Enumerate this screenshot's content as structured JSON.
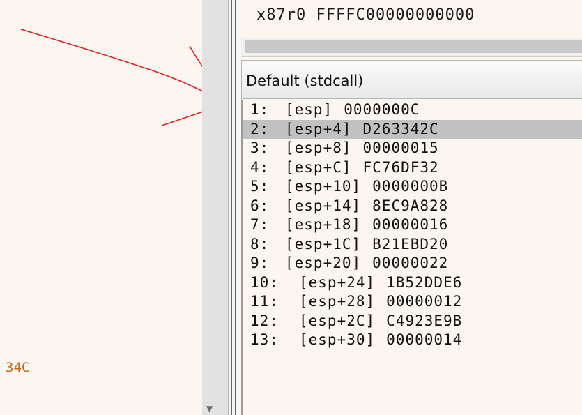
{
  "left_pane": {
    "code_snippet": "34C"
  },
  "registers": {
    "line": "x87r0 FFFFC00000000000"
  },
  "calling_convention": {
    "selected": "Default (stdcall)"
  },
  "stack": {
    "selected_index": 1,
    "rows": [
      {
        "index": "1:",
        "offset": "[esp]",
        "value": "0000000C"
      },
      {
        "index": "2:",
        "offset": "[esp+4]",
        "value": "D263342C"
      },
      {
        "index": "3:",
        "offset": "[esp+8]",
        "value": "00000015"
      },
      {
        "index": "4:",
        "offset": "[esp+C]",
        "value": "FC76DF32"
      },
      {
        "index": "5:",
        "offset": "[esp+10]",
        "value": "0000000B"
      },
      {
        "index": "6:",
        "offset": "[esp+14]",
        "value": "8EC9A828"
      },
      {
        "index": "7:",
        "offset": "[esp+18]",
        "value": "00000016"
      },
      {
        "index": "8:",
        "offset": "[esp+1C]",
        "value": "B21EBD20"
      },
      {
        "index": "9:",
        "offset": "[esp+20]",
        "value": "00000022"
      },
      {
        "index": "10:",
        "offset": "[esp+24]",
        "value": "1B52DDE6"
      },
      {
        "index": "11:",
        "offset": "[esp+28]",
        "value": "00000012"
      },
      {
        "index": "12:",
        "offset": "[esp+2C]",
        "value": "C4923E9B"
      },
      {
        "index": "13:",
        "offset": "[esp+30]",
        "value": "00000014"
      }
    ]
  },
  "colors": {
    "annotation_arrow": "#e02020",
    "selection": "#c1c1c1",
    "code_text": "#c46a1a"
  }
}
